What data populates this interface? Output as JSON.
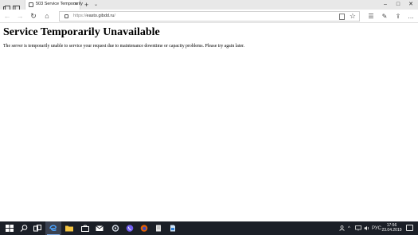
{
  "browser": {
    "tab": {
      "title": "503 Service Temporarily",
      "close": "×"
    },
    "newtab": "+",
    "tabmenu": "⌄",
    "window": {
      "minimize": "–",
      "maximize": "□",
      "close": "✕"
    },
    "nav": {
      "back": "←",
      "forward": "→",
      "refresh": "↻",
      "home": "⌂"
    },
    "address": {
      "scheme": "https://",
      "host": "easto.gibdd.ru",
      "path": "/"
    },
    "toolbar": {
      "favorites": "☆",
      "collections": "☰",
      "pen": "✎",
      "share": "⇪",
      "more": "…"
    }
  },
  "page": {
    "heading": "Service Temporarily Unavailable",
    "message": "The server is temporarily unable to service your request due to maintenance downtime or capacity problems. Please try again later."
  },
  "taskbar": {
    "tray": {
      "language": "РУС",
      "chevron": "^"
    },
    "clock": {
      "time": "17:56",
      "date": "23.04.2019"
    }
  },
  "colors": {
    "taskbar_bg": "#1b1f27",
    "edge_blue": "#2f7fd8",
    "viber_purple": "#7360f2",
    "firefox_orange": "#e66000"
  }
}
